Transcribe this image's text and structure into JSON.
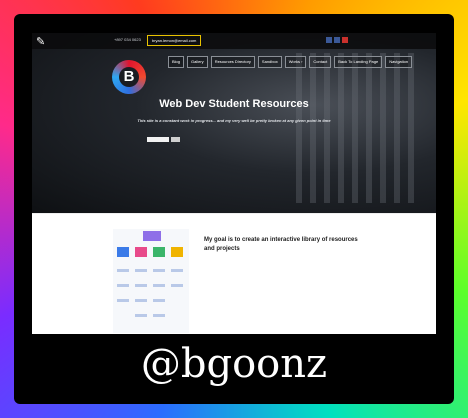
{
  "topbar": {
    "phone": "+897 034 0623",
    "email": "bryan.lemon@email.com",
    "socials": [
      "linkedin",
      "facebook",
      "youtube"
    ]
  },
  "logo_text": "B",
  "nav": [
    "Blog",
    "Gallery",
    "Resources Directory",
    "Sandbox",
    "Works ›",
    "Contact",
    "Back To Landing Page",
    "Navigation"
  ],
  "hero": {
    "title": "Web Dev Student Resources",
    "subtitle": "This site is a constant work in progress... and my very well be pretty broken at any given point in time"
  },
  "section": {
    "goal": "My goal is to create an interactive library of resources and projects"
  },
  "footer_handle": "@bgoonz",
  "colors": {
    "frame": "rainbow-gradient",
    "hero_bg": "#22262c",
    "accent_email": "#e8c200"
  }
}
